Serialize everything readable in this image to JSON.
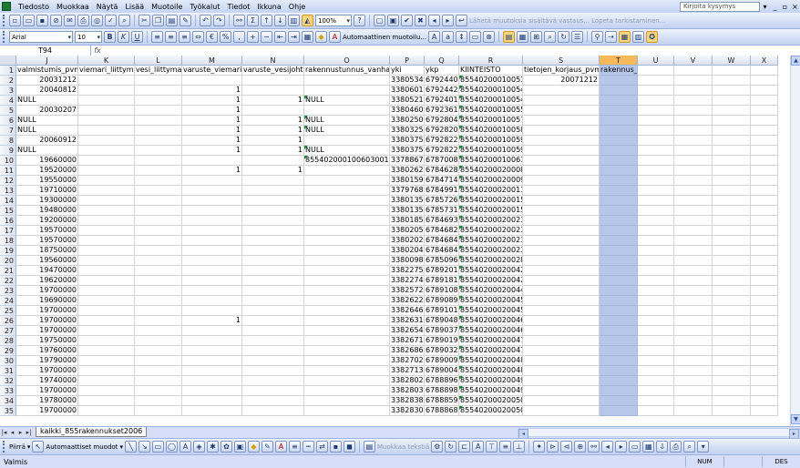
{
  "menubar": {
    "items": [
      "Tiedosto",
      "Muokkaa",
      "Näytä",
      "Lisää",
      "Muotoile",
      "Työkalut",
      "Tiedot",
      "Ikkuna",
      "Ohje"
    ],
    "help_placeholder": "Kirjoita kysymys"
  },
  "toolbar1": {
    "zoom": "100%",
    "review_text_1": "Lähetä muutoksia sisältävä vastaus...",
    "review_text_2": "Lopeta tarkistaminen..."
  },
  "toolbar2": {
    "font_name": "Arial",
    "font_size": "10",
    "autoformat_label": "Automaattinen muotoilu..."
  },
  "formula_bar": {
    "name_box": "T94",
    "fx_label": "fx",
    "formula": ""
  },
  "columns": [
    {
      "letter": "J",
      "header": "valmistumis_pvm"
    },
    {
      "letter": "K",
      "header": "viemari_liittyma"
    },
    {
      "letter": "L",
      "header": "vesi_liittyma"
    },
    {
      "letter": "M",
      "header": "varuste_viemari"
    },
    {
      "letter": "N",
      "header": "varuste_vesijohto"
    },
    {
      "letter": "O",
      "header": "rakennustunnus_vanha"
    },
    {
      "letter": "P",
      "header": "yki"
    },
    {
      "letter": "Q",
      "header": "ykp"
    },
    {
      "letter": "R",
      "header": "KIINTEISTO"
    },
    {
      "letter": "S",
      "header": "tietojen_korjaus_pvm"
    },
    {
      "letter": "T",
      "header": "rakennus_id"
    },
    {
      "letter": "U",
      "header": ""
    },
    {
      "letter": "V",
      "header": ""
    },
    {
      "letter": "W",
      "header": ""
    },
    {
      "letter": "X",
      "header": ""
    }
  ],
  "rows": [
    {
      "n": "2",
      "J": "20031212",
      "K": "",
      "L": "",
      "M": "",
      "N": "",
      "O": "",
      "P": "3380534",
      "Q": "6792440",
      "R": "85540200010053",
      "S": "20071212"
    },
    {
      "n": "3",
      "J": "20040812",
      "K": "",
      "L": "",
      "M": "1",
      "N": "",
      "O": "",
      "P": "3380601",
      "Q": "6792442",
      "R": "85540200010054",
      "S": ""
    },
    {
      "n": "4",
      "J": "NULL",
      "K": "",
      "L": "",
      "M": "1",
      "N": "1",
      "O": "NULL",
      "P": "3380521",
      "Q": "6792401",
      "R": "85540200010054",
      "S": ""
    },
    {
      "n": "5",
      "J": "20030207",
      "K": "",
      "L": "",
      "M": "1",
      "N": "",
      "O": "",
      "P": "3380460",
      "Q": "6792361",
      "R": "85540200010055",
      "S": ""
    },
    {
      "n": "6",
      "J": "NULL",
      "K": "",
      "L": "",
      "M": "1",
      "N": "1",
      "O": "NULL",
      "P": "3380250",
      "Q": "6792804",
      "R": "85540200010057",
      "S": ""
    },
    {
      "n": "7",
      "J": "NULL",
      "K": "",
      "L": "",
      "M": "1",
      "N": "1",
      "O": "NULL",
      "P": "3380325",
      "Q": "6792820",
      "R": "85540200010058",
      "S": ""
    },
    {
      "n": "8",
      "J": "20060912",
      "K": "",
      "L": "",
      "M": "1",
      "N": "1",
      "O": "",
      "P": "3380375",
      "Q": "6792822",
      "R": "85540200010059",
      "S": ""
    },
    {
      "n": "9",
      "J": "NULL",
      "K": "",
      "L": "",
      "M": "1",
      "N": "1",
      "O": "NULL",
      "P": "3380375",
      "Q": "6792822",
      "R": "85540200010059",
      "S": ""
    },
    {
      "n": "10",
      "J": "19660000",
      "K": "",
      "L": "",
      "M": "",
      "N": "",
      "O": "855402000100603001",
      "P": "3378867",
      "Q": "6787008",
      "R": "85540200010061",
      "S": ""
    },
    {
      "n": "11",
      "J": "19520000",
      "K": "",
      "L": "",
      "M": "1",
      "N": "1",
      "O": "",
      "P": "3380262",
      "Q": "6784628",
      "R": "85540200020008",
      "S": ""
    },
    {
      "n": "12",
      "J": "19550000",
      "K": "",
      "L": "",
      "M": "",
      "N": "",
      "O": "",
      "P": "3380159",
      "Q": "6784714",
      "R": "85540200020009",
      "S": ""
    },
    {
      "n": "13",
      "J": "19710000",
      "K": "",
      "L": "",
      "M": "",
      "N": "",
      "O": "",
      "P": "3379768",
      "Q": "6784991",
      "R": "85540200020011",
      "S": ""
    },
    {
      "n": "14",
      "J": "19300000",
      "K": "",
      "L": "",
      "M": "",
      "N": "",
      "O": "",
      "P": "3380135",
      "Q": "6785726",
      "R": "85540200020015",
      "S": ""
    },
    {
      "n": "15",
      "J": "19480000",
      "K": "",
      "L": "",
      "M": "",
      "N": "",
      "O": "",
      "P": "3380135",
      "Q": "6785731",
      "R": "85540200020015",
      "S": ""
    },
    {
      "n": "16",
      "J": "19200000",
      "K": "",
      "L": "",
      "M": "",
      "N": "",
      "O": "",
      "P": "3380185",
      "Q": "6784693",
      "R": "85540200020023",
      "S": ""
    },
    {
      "n": "17",
      "J": "19570000",
      "K": "",
      "L": "",
      "M": "",
      "N": "",
      "O": "",
      "P": "3380205",
      "Q": "6784682",
      "R": "85540200020023",
      "S": ""
    },
    {
      "n": "18",
      "J": "19570000",
      "K": "",
      "L": "",
      "M": "",
      "N": "",
      "O": "",
      "P": "3380202",
      "Q": "6784684",
      "R": "85540200020023",
      "S": ""
    },
    {
      "n": "19",
      "J": "18750000",
      "K": "",
      "L": "",
      "M": "",
      "N": "",
      "O": "",
      "P": "3380204",
      "Q": "6784684",
      "R": "85540200020023",
      "S": ""
    },
    {
      "n": "20",
      "J": "19560000",
      "K": "",
      "L": "",
      "M": "",
      "N": "",
      "O": "",
      "P": "3380098",
      "Q": "6785096",
      "R": "85540200020028",
      "S": ""
    },
    {
      "n": "21",
      "J": "19470000",
      "K": "",
      "L": "",
      "M": "",
      "N": "",
      "O": "",
      "P": "3382275",
      "Q": "6789201",
      "R": "85540200020042",
      "S": ""
    },
    {
      "n": "22",
      "J": "19620000",
      "K": "",
      "L": "",
      "M": "",
      "N": "",
      "O": "",
      "P": "3382274",
      "Q": "6789181",
      "R": "85540200020042",
      "S": ""
    },
    {
      "n": "23",
      "J": "19700000",
      "K": "",
      "L": "",
      "M": "",
      "N": "",
      "O": "",
      "P": "3382572",
      "Q": "6789108",
      "R": "85540200020044",
      "S": ""
    },
    {
      "n": "24",
      "J": "19690000",
      "K": "",
      "L": "",
      "M": "",
      "N": "",
      "O": "",
      "P": "3382622",
      "Q": "6789089",
      "R": "85540200020045",
      "S": ""
    },
    {
      "n": "25",
      "J": "19700000",
      "K": "",
      "L": "",
      "M": "",
      "N": "",
      "O": "",
      "P": "3382646",
      "Q": "6789101",
      "R": "85540200020045",
      "S": ""
    },
    {
      "n": "26",
      "J": "19700000",
      "K": "",
      "L": "",
      "M": "1",
      "N": "",
      "O": "",
      "P": "3382631",
      "Q": "6789048",
      "R": "85540200020046",
      "S": ""
    },
    {
      "n": "27",
      "J": "19700000",
      "K": "",
      "L": "",
      "M": "",
      "N": "",
      "O": "",
      "P": "3382654",
      "Q": "6789037",
      "R": "85540200020046",
      "S": ""
    },
    {
      "n": "28",
      "J": "19750000",
      "K": "",
      "L": "",
      "M": "",
      "N": "",
      "O": "",
      "P": "3382671",
      "Q": "6789019",
      "R": "85540200020047",
      "S": ""
    },
    {
      "n": "29",
      "J": "19760000",
      "K": "",
      "L": "",
      "M": "",
      "N": "",
      "O": "",
      "P": "3382686",
      "Q": "6789032",
      "R": "85540200020047",
      "S": ""
    },
    {
      "n": "30",
      "J": "19790000",
      "K": "",
      "L": "",
      "M": "",
      "N": "",
      "O": "",
      "P": "3382702",
      "Q": "6789009",
      "R": "85540200020048",
      "S": ""
    },
    {
      "n": "31",
      "J": "19700000",
      "K": "",
      "L": "",
      "M": "",
      "N": "",
      "O": "",
      "P": "3382713",
      "Q": "6789004",
      "R": "85540200020048",
      "S": ""
    },
    {
      "n": "32",
      "J": "19740000",
      "K": "",
      "L": "",
      "M": "",
      "N": "",
      "O": "",
      "P": "3382802",
      "Q": "6788896",
      "R": "85540200020049",
      "S": ""
    },
    {
      "n": "33",
      "J": "19700000",
      "K": "",
      "L": "",
      "M": "",
      "N": "",
      "O": "",
      "P": "3382803",
      "Q": "6788898",
      "R": "85540200020049",
      "S": ""
    },
    {
      "n": "34",
      "J": "19780000",
      "K": "",
      "L": "",
      "M": "",
      "N": "",
      "O": "",
      "P": "3382838",
      "Q": "6788859",
      "R": "85540200020050",
      "S": ""
    },
    {
      "n": "35",
      "J": "19700000",
      "K": "",
      "L": "",
      "M": "",
      "N": "",
      "O": "",
      "P": "3382830",
      "Q": "6788868",
      "R": "85540200020050",
      "S": ""
    }
  ],
  "sheet_tab": {
    "name": "kaikki_855rakennukset2006"
  },
  "drawbar": {
    "draw_label": "Piirrä",
    "autoshapes_label": "Automaattiset muodot",
    "edit_text": "Muokkaa tekstiä"
  },
  "status": {
    "text": "Valmis",
    "num": "NUM",
    "des": "DES"
  }
}
